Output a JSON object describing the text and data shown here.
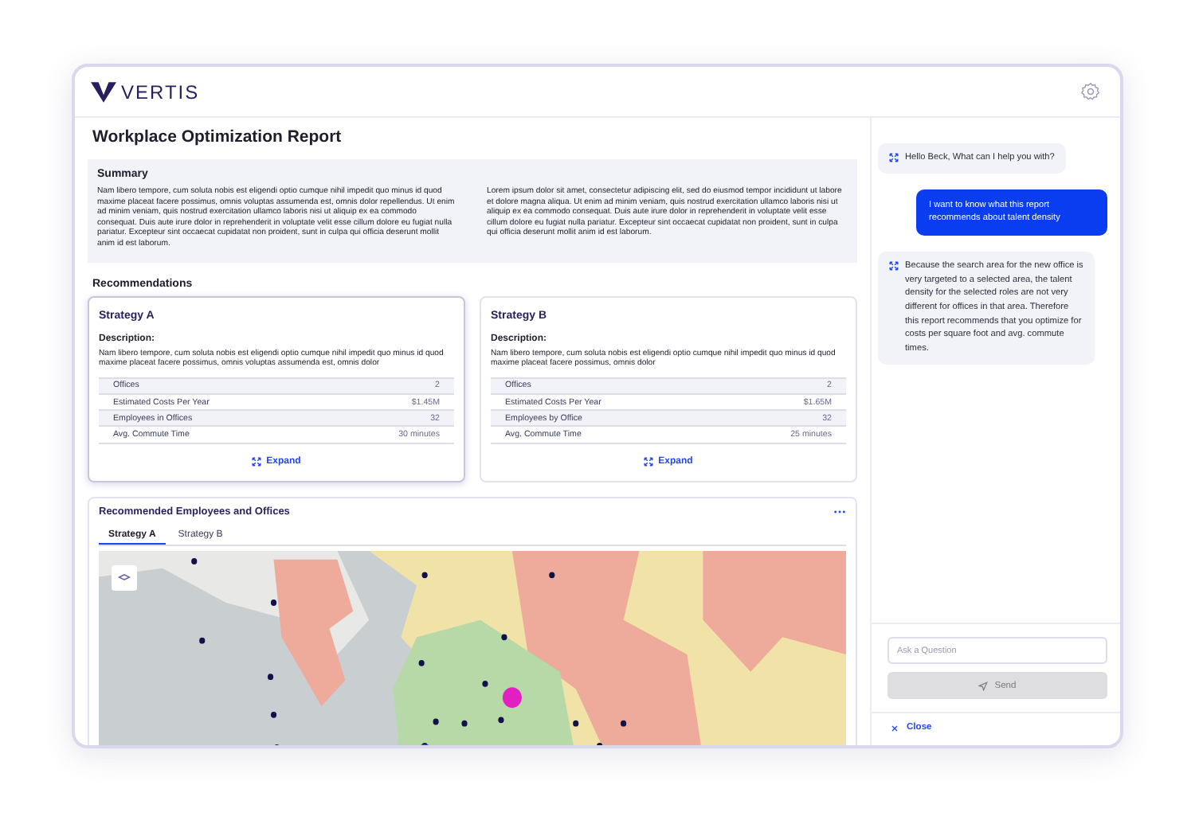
{
  "brand": {
    "name": "VERTIS"
  },
  "report": {
    "title": "Workplace Optimization Report",
    "summary": {
      "heading": "Summary",
      "paragraphs": [
        "Nam libero tempore, cum soluta nobis est eligendi optio cumque nihil impedit quo minus id quod maxime placeat facere possimus, omnis voluptas assumenda est, omnis dolor repellendus. Ut enim ad minim veniam, quis nostrud exercitation ullamco laboris nisi ut aliquip ex ea commodo consequat. Duis aute irure dolor in reprehenderit in voluptate velit esse cillum dolore eu fugiat nulla pariatur. Excepteur sint occaecat cupidatat non proident, sunt in culpa qui officia deserunt mollit anim id est laborum.",
        "Lorem ipsum dolor sit amet, consectetur adipiscing elit, sed do eiusmod tempor incididunt ut labore et dolore magna aliqua. Ut enim ad minim veniam, quis nostrud exercitation ullamco laboris nisi ut aliquip ex ea commodo consequat. Duis aute irure dolor in reprehenderit in voluptate velit esse cillum dolore eu fugiat nulla pariatur. Excepteur sint occaecat cupidatat non proident, sunt in culpa qui officia deserunt mollit anim id est laborum."
      ]
    },
    "recommendations_heading": "Recommendations",
    "strategies": [
      {
        "title": "Strategy A",
        "selected": true,
        "description_label": "Description:",
        "description": "Nam libero tempore, cum soluta nobis est eligendi optio cumque nihil impedit quo minus id quod maxime placeat facere possimus, omnis voluptas assumenda est, omnis dolor",
        "metrics": [
          {
            "label": "Offices",
            "value": "2"
          },
          {
            "label": "Estimated Costs Per Year",
            "value": "$1.45M"
          },
          {
            "label": "Employees in Offices",
            "value": "32"
          },
          {
            "label": "Avg. Commute Time",
            "value": "30 minutes"
          }
        ],
        "expand_label": "Expand"
      },
      {
        "title": "Strategy B",
        "selected": false,
        "description_label": "Description:",
        "description": "Nam libero tempore, cum soluta nobis est eligendi optio cumque nihil impedit quo minus id quod maxime placeat facere possimus, omnis dolor",
        "metrics": [
          {
            "label": "Offices",
            "value": "2"
          },
          {
            "label": "Estimated Costs Per Year",
            "value": "$1.65M"
          },
          {
            "label": "Employees by Office",
            "value": "32"
          },
          {
            "label": "Avg. Commute Time",
            "value": "25 minutes"
          }
        ],
        "expand_label": "Expand"
      }
    ],
    "map_panel": {
      "title": "Recommended Employees and Offices",
      "tabs": [
        {
          "label": "Strategy A",
          "selected": true
        },
        {
          "label": "Strategy B",
          "selected": false
        }
      ]
    }
  },
  "chat": {
    "messages": [
      {
        "kind": "bot",
        "text": "Hello Beck, What can I help you with?"
      },
      {
        "kind": "user",
        "text": "I want to know what this report recommends about talent density"
      },
      {
        "kind": "bot",
        "text": "Because the search area for the new office is very targeted to a selected area, the talent density for the selected roles are not very different for offices in that area. Therefore this report recommends that you optimize for costs per square foot and avg. commute times."
      }
    ],
    "input": {
      "placeholder": "Ask a Question"
    },
    "send": {
      "label": "Send",
      "disabled": true
    },
    "close_label": "Close"
  }
}
